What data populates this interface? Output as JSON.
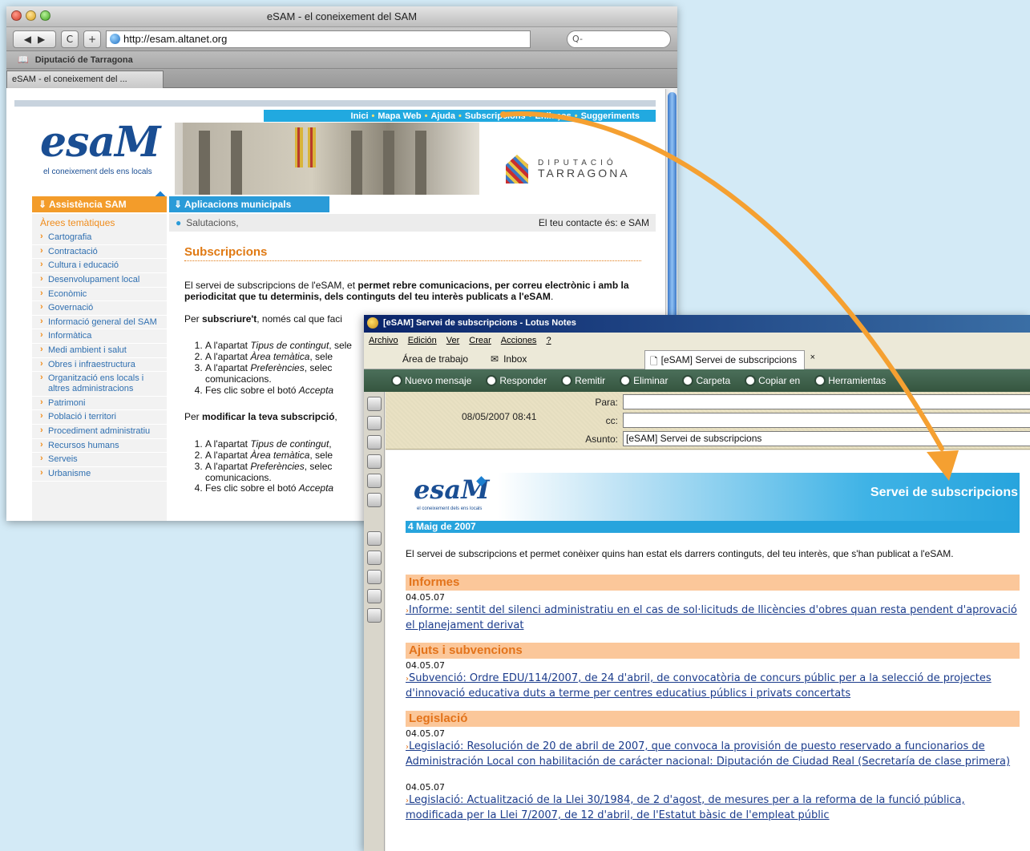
{
  "safari": {
    "title": "eSAM - el coneixement del SAM",
    "url": "http://esam.altanet.org",
    "search_placeholder": "Q-",
    "bookmark": "Diputació de Tarragona",
    "tab": "eSAM - el coneixement del ...",
    "back_label": "◀",
    "forward_label": "▶",
    "reload_label": "C",
    "add_label": "+"
  },
  "esam": {
    "nav": [
      "Inici",
      "Mapa Web",
      "Ajuda",
      "Subscripcions",
      "Enllaços",
      "Suggeriments"
    ],
    "logo": "esaM",
    "logo_sub": "el coneixement dels ens locals",
    "diputacio_line1": "DIPUTACIÓ",
    "diputacio_line2": "TARRAGONA",
    "tab_assistencia": "⇓ Assistència SAM",
    "tab_aplicacions": "⇓ Aplicacions municipals",
    "sidebar_title": "Àrees temàtiques",
    "sidebar_items": [
      "Cartografia",
      "Contractació",
      "Cultura i educació",
      "Desenvolupament local",
      "Econòmic",
      "Governació",
      "Informació general del SAM",
      "Informàtica",
      "Medi ambient i salut",
      "Obres i infraestructura",
      "Organització ens locals i altres administracions",
      "Patrimoni",
      "Població i territori",
      "Procediment administratiu",
      "Recursos humans",
      "Serveis",
      "Urbanisme"
    ],
    "greeting": "Salutacions,",
    "contact": "El teu contacte és:  e SAM",
    "page_title": "Subscripcions",
    "intro_plain": "El servei de subscripcions de l'eSAM, et ",
    "intro_bold": "permet rebre comunicacions, per correu electrònic i amb la periodicitat que tu determinis, dels continguts del teu interès publicats a l'eSAM",
    "intro_end": ".",
    "subscribe_pre": "Per ",
    "subscribe_bold": "subscriure't",
    "subscribe_post": ", només cal que faci",
    "steps": [
      {
        "pre": "A l'apartat ",
        "em": "Tipus de contingut",
        "post": ", sele"
      },
      {
        "pre": "A l'apartat ",
        "em": "Àrea temàtica",
        "post": ", sele"
      },
      {
        "pre": "A l'apartat ",
        "em": "Preferències",
        "post": ", selec"
      },
      {
        "pre": "Fes clic sobre el botó ",
        "em": "Accepta",
        "post": ""
      }
    ],
    "modify_pre": "Per ",
    "modify_bold": "modificar la teva subscripció",
    "modify_post": ",",
    "steps2": [
      {
        "pre": "A l'apartat ",
        "em": "Tipus de contingut",
        "post": ","
      },
      {
        "pre": "A l'apartat ",
        "em": "Àrea temàtica",
        "post": ", sele"
      },
      {
        "pre": "A l'apartat ",
        "em": "Preferències",
        "post": ", selec"
      },
      {
        "pre": "Fes clic sobre el botó ",
        "em": "Accepta",
        "post": ""
      }
    ],
    "step_cont": "comunicacions."
  },
  "notes": {
    "title": "[eSAM] Servei de subscripcions - Lotus Notes",
    "menu": [
      "Archivo",
      "Edición",
      "Ver",
      "Crear",
      "Acciones",
      "?"
    ],
    "tab_home": "Área de trabajo",
    "tab_inbox": "Inbox",
    "tab_doc": "[eSAM] Servei de subscripcions",
    "tab_close": "×",
    "actions": [
      "Nuevo mensaje",
      "Responder",
      "Remitir",
      "Eliminar",
      "Carpeta",
      "Copiar en",
      "Herramientas"
    ],
    "date": "08/05/2007 08:41",
    "label_to": "Para:",
    "label_cc": "cc:",
    "label_subject": "Asunto:",
    "to": "",
    "cc": "",
    "subject": "[eSAM] Servei de subscripcions"
  },
  "newsletter": {
    "logo": "esaM",
    "logo_sub": "el coneixement dels ens locals",
    "banner_title": "Servei de subscripcions",
    "date": "4 Maig de 2007",
    "intro": "El servei de subscripcions et permet conèixer quins han estat els darrers continguts, del teu interès, que s'han publicat a l'eSAM.",
    "sections": [
      {
        "title": "Informes",
        "items": [
          {
            "date": "04.05.07",
            "text": "Informe: sentit del silenci administratiu en el cas de sol·licituds de llicències d'obres quan resta pendent d'aprovació el planejament derivat"
          }
        ]
      },
      {
        "title": "Ajuts i subvencions",
        "items": [
          {
            "date": "04.05.07",
            "text": "Subvenció: Ordre EDU/114/2007, de 24 d'abril, de convocatòria de concurs públic per a la selecció de projectes d'innovació educativa duts a terme per centres educatius públics i privats concertats"
          }
        ]
      },
      {
        "title": "Legislació",
        "items": [
          {
            "date": "04.05.07",
            "text": "Legislació: Resolución de 20 de abril de 2007, que convoca la provisión de puesto reservado a funcionarios de Administración Local con habilitación de carácter nacional: Diputación de Ciudad Real (Secretaría de clase primera)"
          },
          {
            "date": "04.05.07",
            "text": "Legislació: Actualització de la Llei 30/1984, de 2 d'agost, de mesures per a la reforma de la funció pública, modificada per la Llei 7/2007, de 12 d'abril, de l'Estatut bàsic de l'empleat públic"
          }
        ]
      }
    ]
  },
  "colors": {
    "background": "#d3eaf6",
    "esam_orange": "#f39c2a",
    "esam_blue": "#2a9bd8",
    "arrow": "#f5a031"
  }
}
